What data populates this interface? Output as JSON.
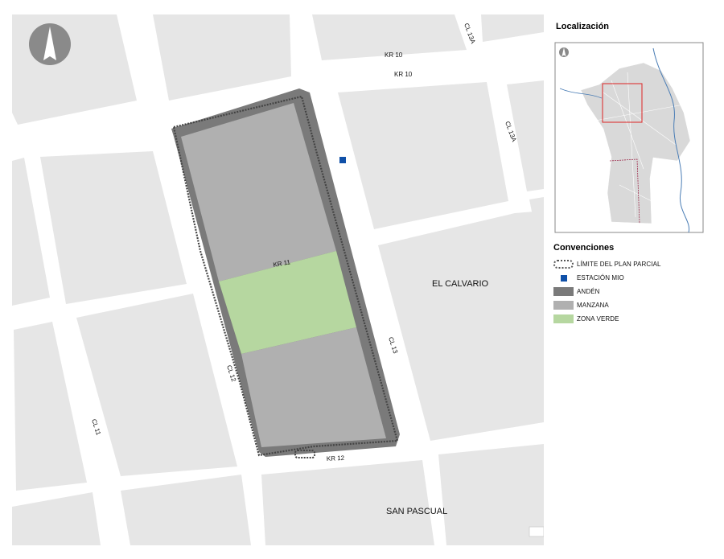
{
  "map": {
    "streets": {
      "kr10_top": "KR 10",
      "kr10_lower": "KR 10",
      "cl13a_top": "CL 13A",
      "cl13a_right": "CL 13A",
      "kr11": "KR 11",
      "cl13": "CL 13",
      "cl12": "CL 12",
      "cl11": "CL 11",
      "kr12": "KR 12"
    },
    "areas": {
      "el_calvario": "EL CALVARIO",
      "san_pascual": "SAN PASCUAL"
    }
  },
  "localizacion": {
    "title": "Localización"
  },
  "convenciones": {
    "title": "Convenciones",
    "items": [
      {
        "label": "LÍMITE DEL PLAN PARCIAL",
        "icon": "dotted-boundary-icon"
      },
      {
        "label": "ESTACIÓN MIO",
        "icon": "station-square-icon",
        "color": "#1050a8"
      },
      {
        "label": "ANDÉN",
        "color": "#7a7a7a"
      },
      {
        "label": "MANZANA",
        "color": "#b0b0b0"
      },
      {
        "label": "ZONA VERDE",
        "color": "#b6d7a0"
      }
    ]
  }
}
